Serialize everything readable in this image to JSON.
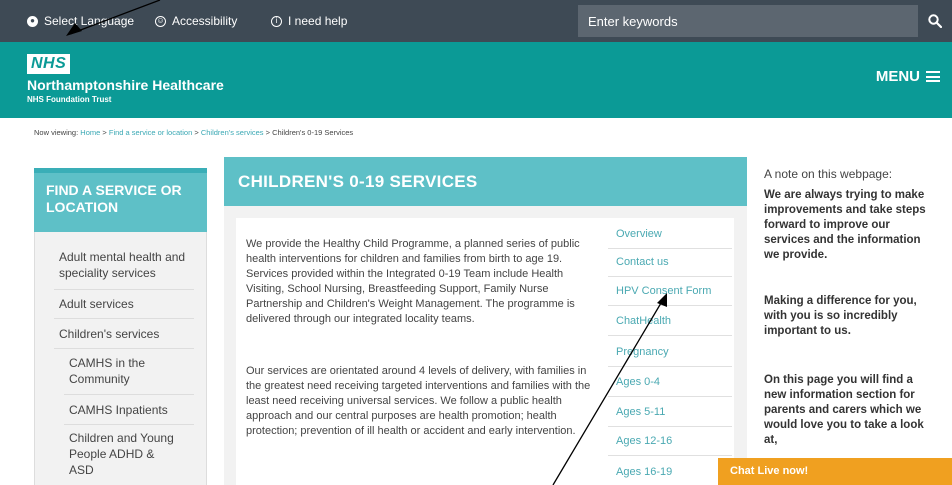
{
  "topbar": {
    "select_language": "Select Language",
    "accessibility": "Accessibility",
    "help": "I need help",
    "search_placeholder": "Enter keywords"
  },
  "header": {
    "logo": "NHS",
    "org_name": "Northamptonshire Healthcare",
    "org_sub": "NHS Foundation Trust",
    "menu_label": "MENU"
  },
  "breadcrumb": {
    "prefix": "Now viewing:",
    "items": [
      "Home",
      "Find a service or location",
      "Children's services"
    ],
    "current": "Children's 0-19 Services",
    "separator": ">"
  },
  "sidebar": {
    "title": "FIND A SERVICE OR LOCATION",
    "items": [
      {
        "label": "Adult mental health and speciality services"
      },
      {
        "label": "Adult services"
      },
      {
        "label": "Children's services"
      },
      {
        "label": "CAMHS in the Community"
      },
      {
        "label": "CAMHS Inpatients"
      },
      {
        "label": "Children and Young People ADHD & ASD"
      }
    ]
  },
  "content": {
    "title": "CHILDREN'S 0-19 SERVICES",
    "paragraphs": [
      "We provide the Healthy Child Programme, a planned series of public health interventions for children and families from birth to age 19. Services provided within the Integrated 0-19 Team include Health Visiting, School Nursing, Breastfeeding Support, Family Nurse Partnership and Children's Weight Management. The programme is delivered through our integrated locality teams.",
      "Our services are orientated around 4 levels of delivery, with families in the greatest need receiving targeted interventions and families with the least need receiving universal services. We follow a public health approach and our central purposes are health promotion; health protection; prevention of ill health or accident and early intervention."
    ]
  },
  "toc": {
    "items": [
      "Overview",
      "Contact us",
      "HPV Consent Form",
      "ChatHealth",
      "Pregnancy",
      "Ages 0-4",
      "Ages 5-11",
      "Ages 12-16",
      "Ages 16-19"
    ]
  },
  "note": {
    "title": "A note on this webpage:",
    "paragraphs": [
      "We are always trying to make improvements and take steps forward to improve our services and the information we provide.",
      "Making a difference for you, with you is so incredibly important to us.",
      "On this page you will find a new information section for parents and carers which we would love you to take a look at,"
    ]
  },
  "chat": {
    "label": "Chat Live now!"
  }
}
